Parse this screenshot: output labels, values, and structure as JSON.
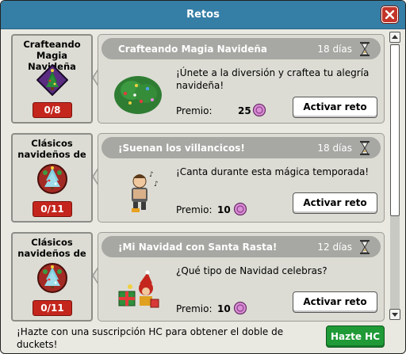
{
  "window": {
    "title": "Retos"
  },
  "challenges": [
    {
      "badge_title": "Crafteando Magia Navideña",
      "progress": "0/8",
      "title": "Crafteando Magia Navideña",
      "days": "18 días",
      "description": "¡Únete a la diversión y craftea tu alegría navideña!",
      "prize_label": "Premio:",
      "prize_value": "25",
      "button_label": "Activar reto"
    },
    {
      "badge_title": "Clásicos navideños de",
      "progress": "0/11",
      "title": "¡Suenan los villancicos!",
      "days": "18 días",
      "description": "¡Canta durante esta mágica temporada!",
      "prize_label": "Premio:",
      "prize_value": "10",
      "button_label": "Activar reto"
    },
    {
      "badge_title": "Clásicos navideños de",
      "progress": "0/11",
      "title": "¡Mi Navidad con Santa Rasta!",
      "days": "12 días",
      "description": "¿Qué tipo de Navidad celebras?",
      "prize_label": "Premio:",
      "prize_value": "10",
      "button_label": "Activar reto"
    }
  ],
  "footer": {
    "text": "¡Hazte con una suscripción HC para obtener el doble de duckets!",
    "button_label": "Hazte HC"
  },
  "colors": {
    "titlebar": "#357ea6",
    "close_button": "#c3352a",
    "progress_badge": "#c4261d",
    "hc_button": "#1f9a36",
    "card_header": "#a7a7a3"
  }
}
